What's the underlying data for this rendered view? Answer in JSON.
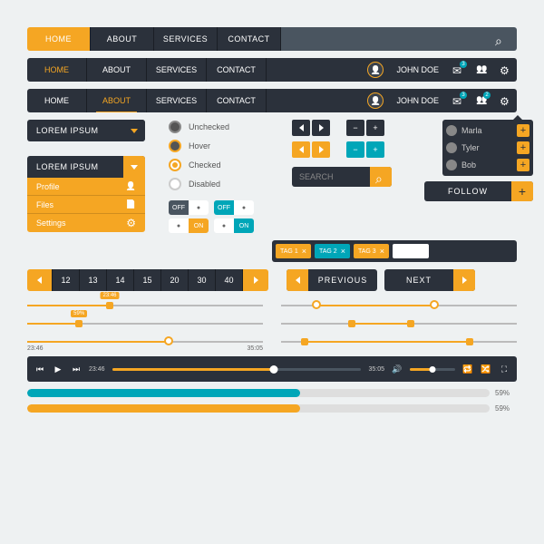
{
  "nav": {
    "items": [
      "Home",
      "About",
      "Services",
      "Contact"
    ],
    "active": 0,
    "user": "John Doe",
    "mail_badge": "3",
    "users_badge": "2"
  },
  "nav2_active": 1,
  "nav3_active": 1,
  "dropdown": {
    "label": "Lorem Ipsum"
  },
  "menu": {
    "items": [
      {
        "label": "Profile",
        "icon": "user"
      },
      {
        "label": "Files",
        "icon": "file"
      },
      {
        "label": "Settings",
        "icon": "gear"
      }
    ]
  },
  "radios": {
    "unchecked": "Unchecked",
    "hover": "Hover",
    "checked": "Checked",
    "disabled": "Disabled"
  },
  "toggles": {
    "off": "OFF",
    "on": "ON"
  },
  "search": {
    "placeholder": "Search"
  },
  "follow": {
    "label": "Follow"
  },
  "popup": {
    "names": [
      "Marla",
      "Tyler",
      "Bob"
    ]
  },
  "tags": [
    "Tag 1",
    "Tag 2",
    "Tag 3"
  ],
  "pagination": [
    "12",
    "13",
    "14",
    "15",
    "20",
    "30",
    "40"
  ],
  "prev": "Previous",
  "next": "Next",
  "sliders": {
    "a_bubble": "23:46",
    "b_bubble": "59%",
    "c_start": "23:46",
    "c_end": "35:05"
  },
  "player": {
    "cur": "23:46",
    "dur": "35:05"
  },
  "progress": {
    "a": "59%",
    "b": "59%"
  }
}
